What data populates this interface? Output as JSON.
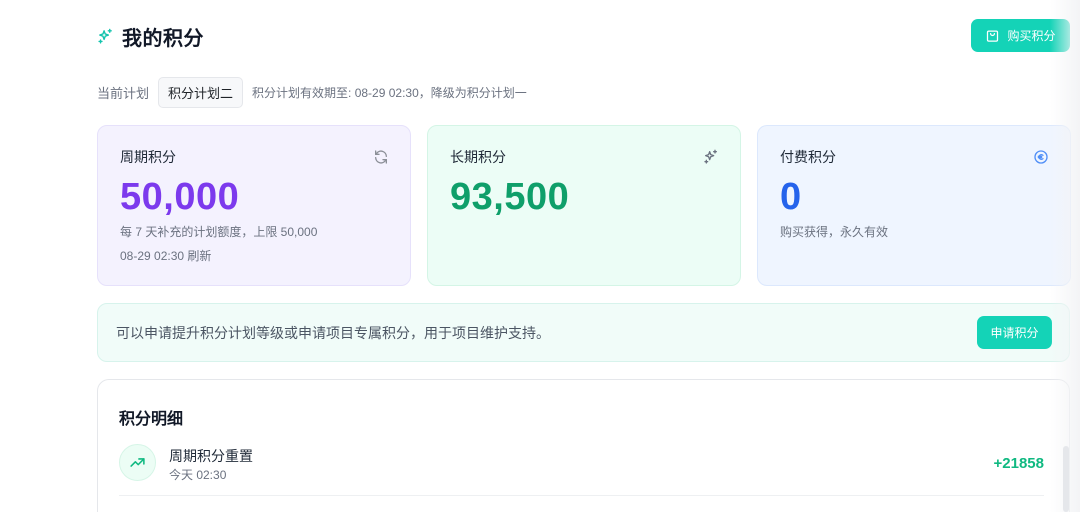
{
  "header": {
    "title": "我的积分",
    "buy_button_label": "购买积分"
  },
  "plan": {
    "label": "当前计划",
    "current_plan": "积分计划二",
    "note": "积分计划有效期至: 08-29 02:30，降级为积分计划一"
  },
  "cards": [
    {
      "label": "周期积分",
      "value": "50,000",
      "sub": "每 7 天补充的计划额度，上限 50,000",
      "sub2": "08-29 02:30 刷新",
      "icon": "refresh-icon"
    },
    {
      "label": "长期积分",
      "value": "93,500",
      "icon": "sparkle-icon"
    },
    {
      "label": "付费积分",
      "value": "0",
      "sub": "购买获得，永久有效",
      "icon": "coin-icon"
    }
  ],
  "notice": {
    "text": "可以申请提升积分计划等级或申请项目专属积分，用于项目维护支持。",
    "apply_button_label": "申请积分"
  },
  "details": {
    "title": "积分明细",
    "items": [
      {
        "title": "周期积分重置",
        "time": "今天 02:30",
        "amount": "+21858",
        "icon": "trending-up-icon"
      }
    ]
  },
  "colors": {
    "accent": "#14d3b7",
    "purple": "#7c3aed",
    "green": "#0f9f6a",
    "blue": "#2563eb",
    "positive": "#10b981"
  }
}
